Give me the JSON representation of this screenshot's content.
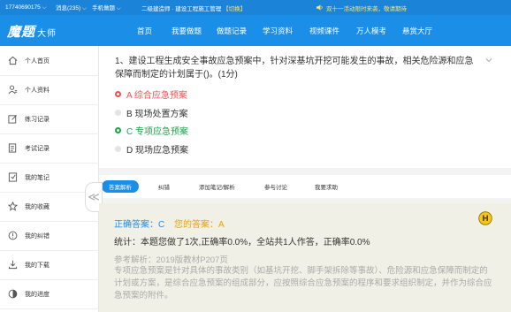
{
  "topbar": {
    "phone": "17740690175 ⌵",
    "messages": "消息(235) ⌵",
    "mobile": "手机做题 ⌵",
    "title": "二级建造师 · 建设工程施工管理",
    "switch": "【切换】",
    "promo": "双十一活动限时来袭，敬请期待"
  },
  "logo": {
    "main": "魔题",
    "sub": "大师"
  },
  "nav": [
    "首页",
    "我要做题",
    "做题记录",
    "学习资料",
    "视频课件",
    "万人模考",
    "悬赏大厅"
  ],
  "sidebar": [
    {
      "label": "个人首页",
      "icon": "home-icon"
    },
    {
      "label": "个人资料",
      "icon": "profile-icon"
    },
    {
      "label": "练习记录",
      "icon": "edit-record-icon"
    },
    {
      "label": "考试记录",
      "icon": "exam-record-icon"
    },
    {
      "label": "我的笔记",
      "icon": "note-icon"
    },
    {
      "label": "我的收藏",
      "icon": "star-icon"
    },
    {
      "label": "我的纠错",
      "icon": "error-icon"
    },
    {
      "label": "我的下载",
      "icon": "download-icon"
    },
    {
      "label": "我的进度",
      "icon": "progress-icon"
    }
  ],
  "question": {
    "text": "1、建设工程生成安全事故应急预案中，针对深基坑开挖可能发生的事故，相关危险源和应急保障而制定的计划属于()。(1分)",
    "options": [
      {
        "label": "A 综合应急预案",
        "state": "wrong"
      },
      {
        "label": "B 现场处置方案",
        "state": "none"
      },
      {
        "label": "C 专项应急预案",
        "state": "correct"
      },
      {
        "label": "D 现场应急预案",
        "state": "none"
      }
    ]
  },
  "tabs": [
    "答案解析",
    "纠错",
    "添加笔记/解析",
    "参与讨论",
    "我要求助"
  ],
  "collapse_glyph": "≪",
  "answer": {
    "correct": "正确答案：C",
    "mine": "您的答案：A",
    "stats": "统计：本题您做了1次,正确率0.0%，全站共1人作答，正确率0.0%",
    "reference": "参考解析：2019版教材P207页",
    "explanation": "专项应急预案是针对具体的事故类别（如基坑开挖、脚手架拆除等事故）、危险源和应急保障而制定的计划或方案，是综合应急预案的组成部分，应按照综合应急预案的程序和要求组织制定，并作为综合应急预案的附件。"
  },
  "colors": {
    "primary": "#1b8ee8",
    "wrong": "#f05050",
    "correct": "#1aa34a",
    "mine": "#f0a000"
  }
}
